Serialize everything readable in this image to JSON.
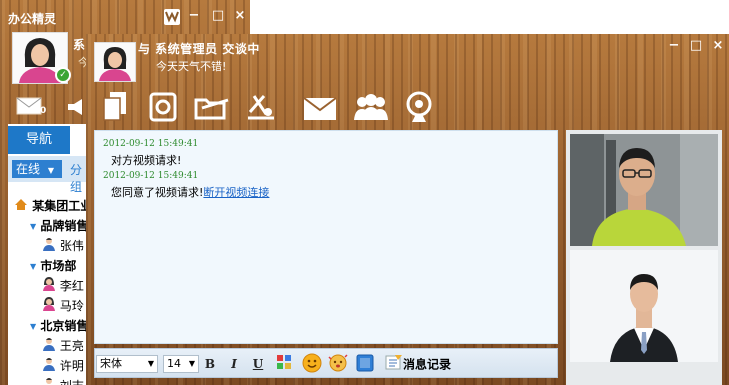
{
  "colors": {
    "accent": "#1e78c8",
    "wood": "#9a6230",
    "online": "#3aa534",
    "msg_meta": "#2e8b2e"
  },
  "main": {
    "title": "办公精灵",
    "user_name_partial": "系",
    "user_sign_partial": "今",
    "mail_count": "0",
    "window_buttons": [
      "−",
      "□",
      "×"
    ],
    "nav_tab": "导航",
    "status": "在线",
    "group_tab": "分组",
    "tree": [
      {
        "type": "root",
        "label": "某集团工业",
        "icon": "house-icon"
      },
      {
        "type": "group",
        "label": "品牌销售",
        "icon": "chevron-down-icon"
      },
      {
        "type": "user",
        "label": "张伟",
        "icon": "male-user-icon"
      },
      {
        "type": "group",
        "label": "市场部",
        "icon": "chevron-down-icon"
      },
      {
        "type": "user",
        "label": "李红",
        "icon": "female-user-icon"
      },
      {
        "type": "user",
        "label": "马玲",
        "icon": "female-user-icon"
      },
      {
        "type": "group",
        "label": "北京销售",
        "icon": "chevron-down-icon"
      },
      {
        "type": "user",
        "label": "王亮",
        "icon": "male-user-icon"
      },
      {
        "type": "user",
        "label": "许明",
        "icon": "male-user-icon"
      },
      {
        "type": "user",
        "label": "刘志",
        "icon": "male-user-icon"
      }
    ]
  },
  "chat": {
    "title": "与  系统管理员  交谈中",
    "signature": "今天天气不错!",
    "window_buttons": [
      "−",
      "□",
      "×"
    ],
    "toolbar": [
      "copy-icon",
      "disk-icon",
      "folder-icon",
      "scissors-icon",
      "mail-icon",
      "group-icon",
      "webcam-icon"
    ],
    "messages": [
      {
        "meta": "2012-09-12 15:49:41",
        "text": "对方视频请求!",
        "link": ""
      },
      {
        "meta": "2012-09-12 15:49:41",
        "text": "您同意了视频请求!",
        "link": "断开视频连接"
      }
    ],
    "format": {
      "font": "宋体",
      "size": "14",
      "bold": "B",
      "italic": "I",
      "underline": "U",
      "history": "消息记录"
    }
  }
}
